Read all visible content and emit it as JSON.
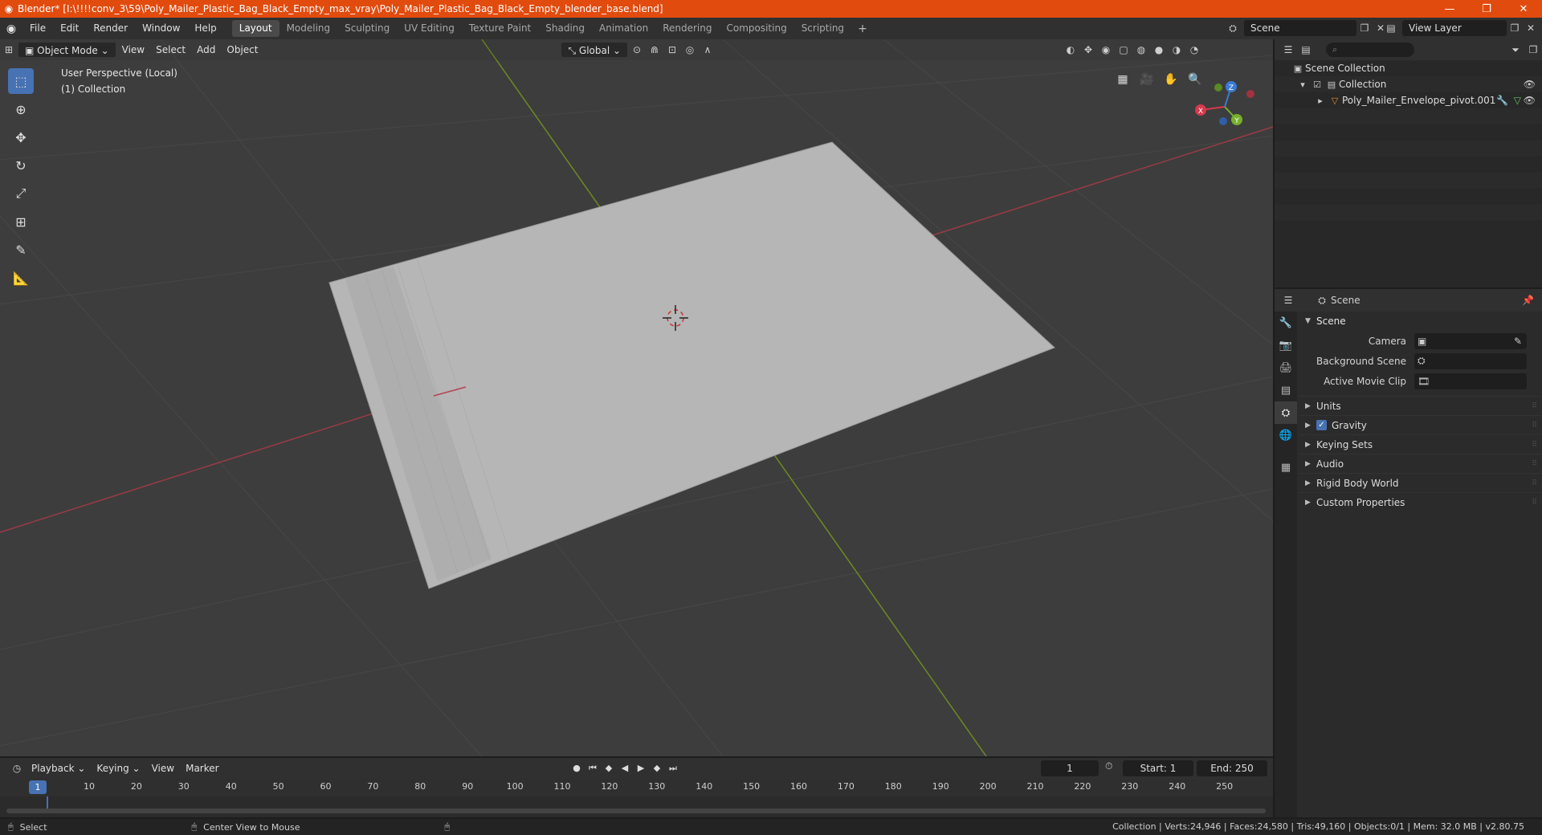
{
  "window": {
    "title": "Blender* [I:\\!!!!conv_3\\59\\Poly_Mailer_Plastic_Bag_Black_Empty_max_vray\\Poly_Mailer_Plastic_Bag_Black_Empty_blender_base.blend]",
    "minimize": "—",
    "maximize": "❐",
    "close": "✕"
  },
  "menu": {
    "items": [
      "File",
      "Edit",
      "Render",
      "Window",
      "Help"
    ],
    "workspaces": [
      "Layout",
      "Modeling",
      "Sculpting",
      "UV Editing",
      "Texture Paint",
      "Shading",
      "Animation",
      "Rendering",
      "Compositing",
      "Scripting"
    ],
    "active_workspace": "Layout",
    "add_tab": "+",
    "scene": "Scene",
    "view_layer": "View Layer"
  },
  "viewport": {
    "mode": "Object Mode",
    "menus": [
      "View",
      "Select",
      "Add",
      "Object"
    ],
    "orientation": "Global",
    "perspective": "User Perspective (Local)",
    "collection": "(1) Collection",
    "axes": {
      "x": "X",
      "y": "Y",
      "z": "Z"
    }
  },
  "outliner": {
    "search_placeholder": "",
    "rows": [
      {
        "label": "Scene Collection"
      },
      {
        "label": "Collection"
      },
      {
        "label": "Poly_Mailer_Envelope_pivot.001"
      }
    ]
  },
  "properties": {
    "context": "Scene",
    "panel": "Scene",
    "fields": [
      {
        "label": "Camera"
      },
      {
        "label": "Background Scene"
      },
      {
        "label": "Active Movie Clip"
      }
    ],
    "subpanels": [
      "Units",
      "Gravity",
      "Keying Sets",
      "Audio",
      "Rigid Body World",
      "Custom Properties"
    ]
  },
  "timeline": {
    "menus": [
      "Playback",
      "Keying",
      "View",
      "Marker"
    ],
    "current_frame": "1",
    "start_label": "Start:",
    "start": "1",
    "end_label": "End:",
    "end": "250",
    "ruler": [
      "10",
      "20",
      "30",
      "40",
      "50",
      "60",
      "70",
      "80",
      "90",
      "100",
      "110",
      "120",
      "130",
      "140",
      "150",
      "160",
      "170",
      "180",
      "190",
      "200",
      "210",
      "220",
      "230",
      "240",
      "250"
    ]
  },
  "status": {
    "select": "Select",
    "center_view": "Center View to Mouse",
    "stats": "Collection | Verts:24,946 | Faces:24,580 | Tris:49,160 | Objects:0/1 | Mem: 32.0 MB | v2.80.75"
  }
}
